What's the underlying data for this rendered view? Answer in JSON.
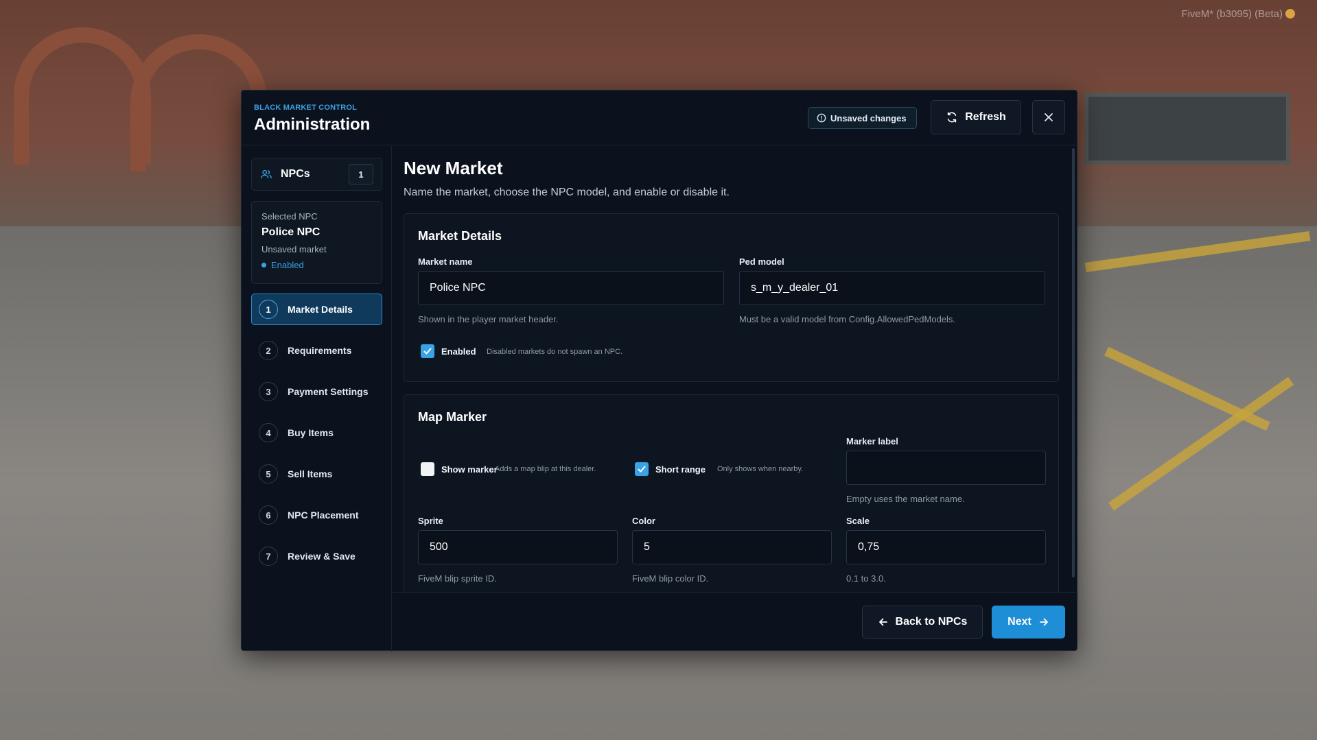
{
  "watermark": "FiveM* (b3095) (Beta)",
  "header": {
    "eyebrow": "BLACK MARKET CONTROL",
    "title": "Administration",
    "unsaved_label": "Unsaved changes",
    "refresh_label": "Refresh"
  },
  "sidebar": {
    "npcs_label": "NPCs",
    "npcs_count": "1",
    "selected": {
      "label": "Selected NPC",
      "name": "Police NPC",
      "subtitle": "Unsaved market",
      "status": "Enabled"
    },
    "steps": [
      {
        "num": "1",
        "label": "Market Details",
        "active": true
      },
      {
        "num": "2",
        "label": "Requirements"
      },
      {
        "num": "3",
        "label": "Payment Settings"
      },
      {
        "num": "4",
        "label": "Buy Items"
      },
      {
        "num": "5",
        "label": "Sell Items"
      },
      {
        "num": "6",
        "label": "NPC Placement"
      },
      {
        "num": "7",
        "label": "Review & Save"
      }
    ]
  },
  "main": {
    "title": "New Market",
    "description": "Name the market, choose the NPC model, and enable or disable it.",
    "market_details": {
      "title": "Market Details",
      "market_name_label": "Market name",
      "market_name_value": "Police NPC",
      "market_name_hint": "Shown in the player market header.",
      "ped_model_label": "Ped model",
      "ped_model_value": "s_m_y_dealer_01",
      "ped_model_hint": "Must be a valid model from Config.AllowedPedModels.",
      "enabled_label": "Enabled",
      "enabled_checked": true,
      "enabled_hint": "Disabled markets do not spawn an NPC."
    },
    "map_marker": {
      "title": "Map Marker",
      "show_marker_label": "Show marker",
      "show_marker_checked": false,
      "show_marker_hint": "Adds a map blip at this dealer.",
      "short_range_label": "Short range",
      "short_range_checked": true,
      "short_range_hint": "Only shows when nearby.",
      "marker_label_label": "Marker label",
      "marker_label_value": "",
      "marker_label_hint": "Empty uses the market name.",
      "sprite_label": "Sprite",
      "sprite_value": "500",
      "sprite_hint": "FiveM blip sprite ID.",
      "color_label": "Color",
      "color_value": "5",
      "color_hint": "FiveM blip color ID.",
      "scale_label": "Scale",
      "scale_value": "0,75",
      "scale_hint": "0.1 to 3.0."
    }
  },
  "footer": {
    "back_label": "Back to NPCs",
    "next_label": "Next"
  },
  "colors": {
    "accent": "#3aa3e6",
    "primary_button": "#1e8fd6",
    "panel_bg": "#0b121d"
  }
}
